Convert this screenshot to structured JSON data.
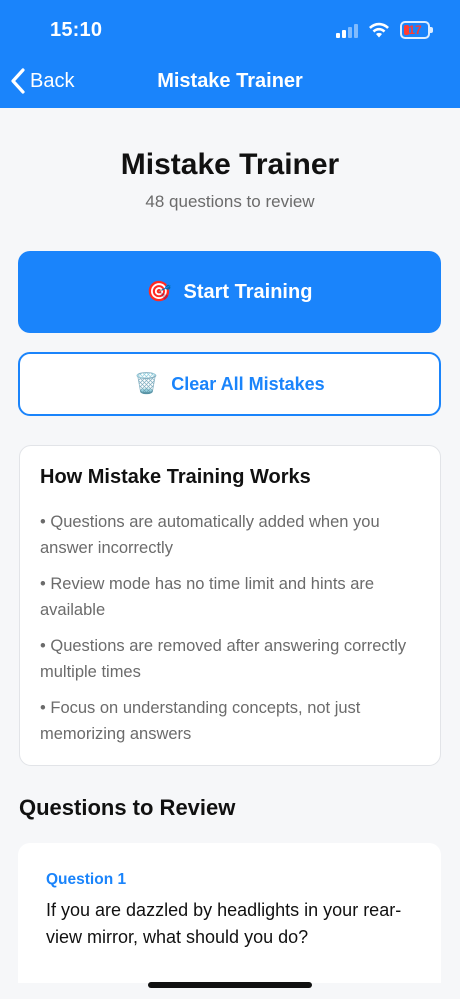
{
  "status_bar": {
    "time": "15:10",
    "battery": "17"
  },
  "nav": {
    "back_label": "Back",
    "title": "Mistake Trainer"
  },
  "page": {
    "title": "Mistake Trainer",
    "subtitle": "48 questions to review"
  },
  "actions": {
    "start_icon": "🎯",
    "start_label": "Start Training",
    "clear_icon": "🗑️",
    "clear_label": "Clear All Mistakes"
  },
  "info_card": {
    "title": "How Mistake Training Works",
    "items": [
      "• Questions are automatically added when you answer incorrectly",
      "• Review mode has no time limit and hints are available",
      "• Questions are removed after answering correctly multiple times",
      "• Focus on understanding concepts, not just memorizing answers"
    ]
  },
  "review": {
    "section_title": "Questions to Review",
    "questions": [
      {
        "label": "Question 1",
        "text": "If you are dazzled by headlights in your rear-view mirror, what should you do?"
      }
    ]
  },
  "colors": {
    "primary": "#1a84fb",
    "background": "#f6f7f9",
    "muted_text": "#6b6b6b",
    "battery_low": "#ff3b30"
  }
}
